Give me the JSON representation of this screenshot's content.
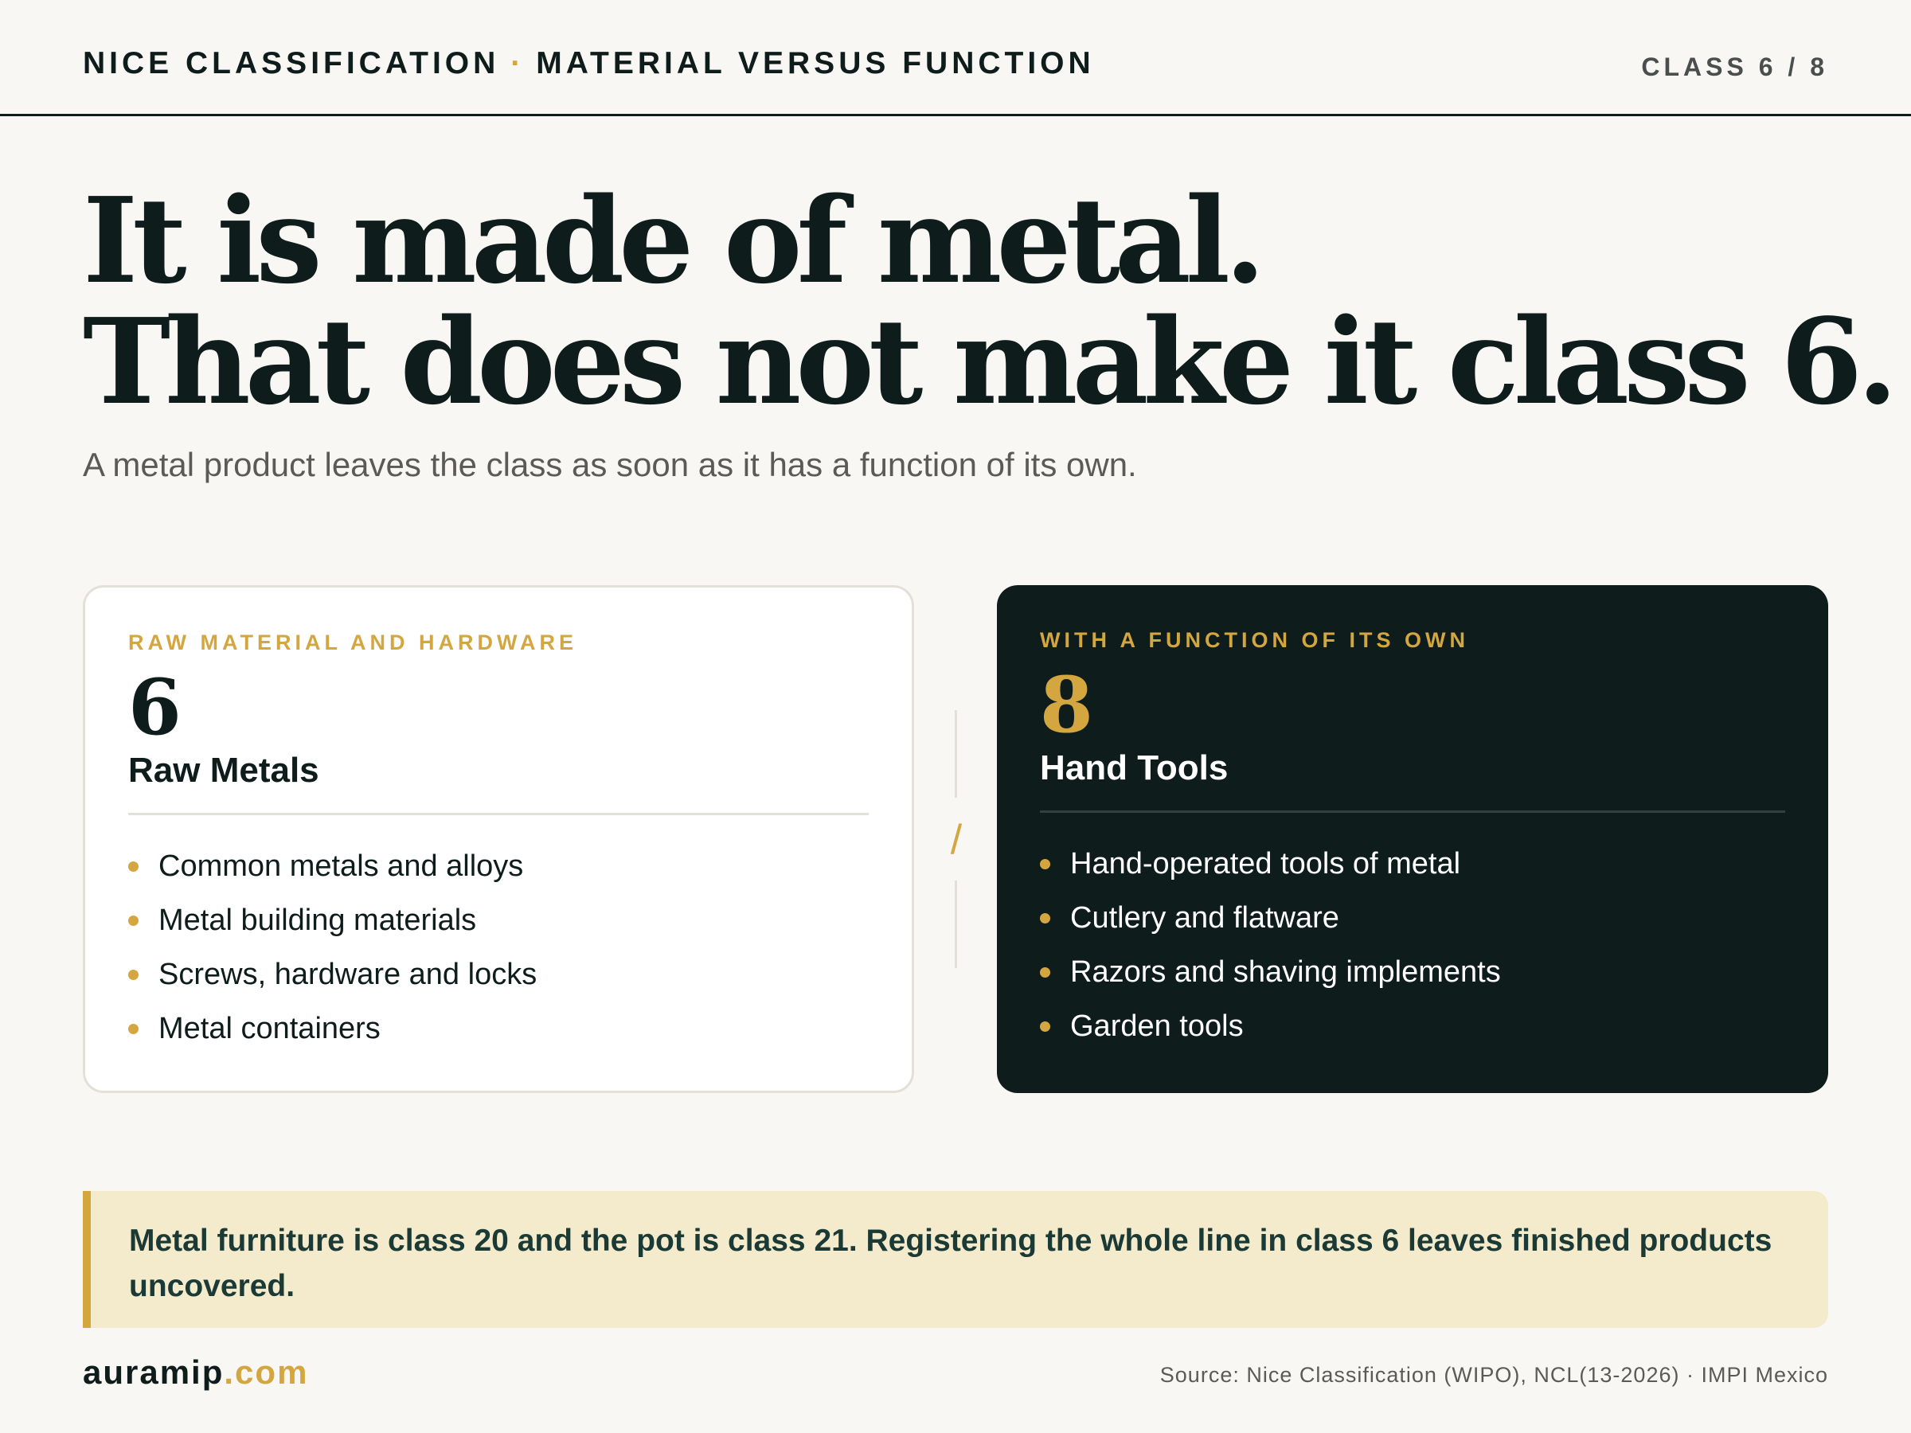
{
  "header": {
    "series": "NICE CLASSIFICATION",
    "separator": "·",
    "topic": "MATERIAL VERSUS FUNCTION",
    "class_indicator": "CLASS 6 / 8"
  },
  "headline": {
    "line1": "It is made of metal.",
    "line2": "That does not make it class 6."
  },
  "subhead": "A metal product leaves the class as soon as it has a function of its own.",
  "cards": {
    "left": {
      "kicker": "RAW MATERIAL AND HARDWARE",
      "number": "6",
      "title": "Raw Metals",
      "items": [
        "Common metals and alloys",
        "Metal building materials",
        "Screws, hardware and locks",
        "Metal containers"
      ]
    },
    "right": {
      "kicker": "WITH A FUNCTION OF ITS OWN",
      "number": "8",
      "title": "Hand Tools",
      "items": [
        "Hand-operated tools of metal",
        "Cutlery and flatware",
        "Razors and shaving implements",
        "Garden tools"
      ]
    }
  },
  "divider": "/",
  "callout": "Metal furniture is class 20 and the pot is class 21. Registering the whole line in class 6 leaves finished products uncovered.",
  "footer": {
    "brand_name": "auramip",
    "brand_tld": ".com",
    "source": "Source: Nice Classification (WIPO), NCL(13-2026) · IMPI Mexico"
  },
  "colors": {
    "accent": "#d4a640",
    "ink": "#0f1c1c",
    "background": "#f8f7f4",
    "callout_bg": "#f4ebcd"
  }
}
